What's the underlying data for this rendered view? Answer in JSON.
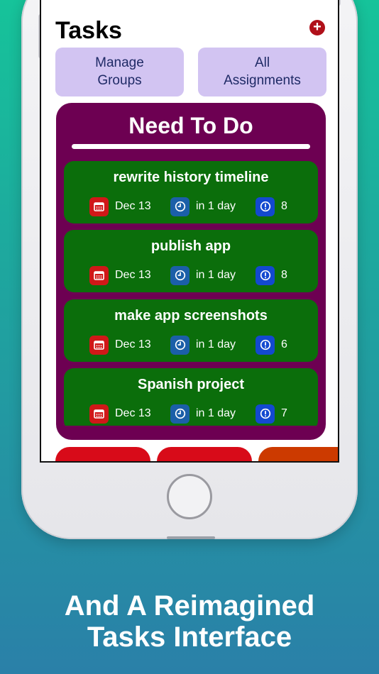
{
  "screen": {
    "title": "Tasks",
    "add_button_symbol": "+",
    "buttons": [
      {
        "label": "Manage\nGroups"
      },
      {
        "label": "All\nAssignments"
      }
    ],
    "section": {
      "title": "Need To Do",
      "tasks": [
        {
          "name": "rewrite history timeline",
          "date": "Dec 13",
          "due": "in 1 day",
          "priority": "8"
        },
        {
          "name": "publish app",
          "date": "Dec 13",
          "due": "in 1 day",
          "priority": "8"
        },
        {
          "name": "make app screenshots",
          "date": "Dec 13",
          "due": "in 1 day",
          "priority": "6"
        },
        {
          "name": "Spanish project",
          "date": "Dec 13",
          "due": "in 1 day",
          "priority": "7"
        }
      ]
    },
    "bottom_tab_colors": [
      "#d80b19",
      "#d80b19",
      "#cc3a00"
    ]
  },
  "caption": {
    "line1": "And A Reimagined",
    "line2": "Tasks Interface"
  },
  "colors": {
    "panel": "#6d0052",
    "card": "#0b6e0b",
    "button": "#d2c4f2"
  },
  "icons": [
    "calendar-icon",
    "clock-icon",
    "alert-icon",
    "plus-icon"
  ]
}
